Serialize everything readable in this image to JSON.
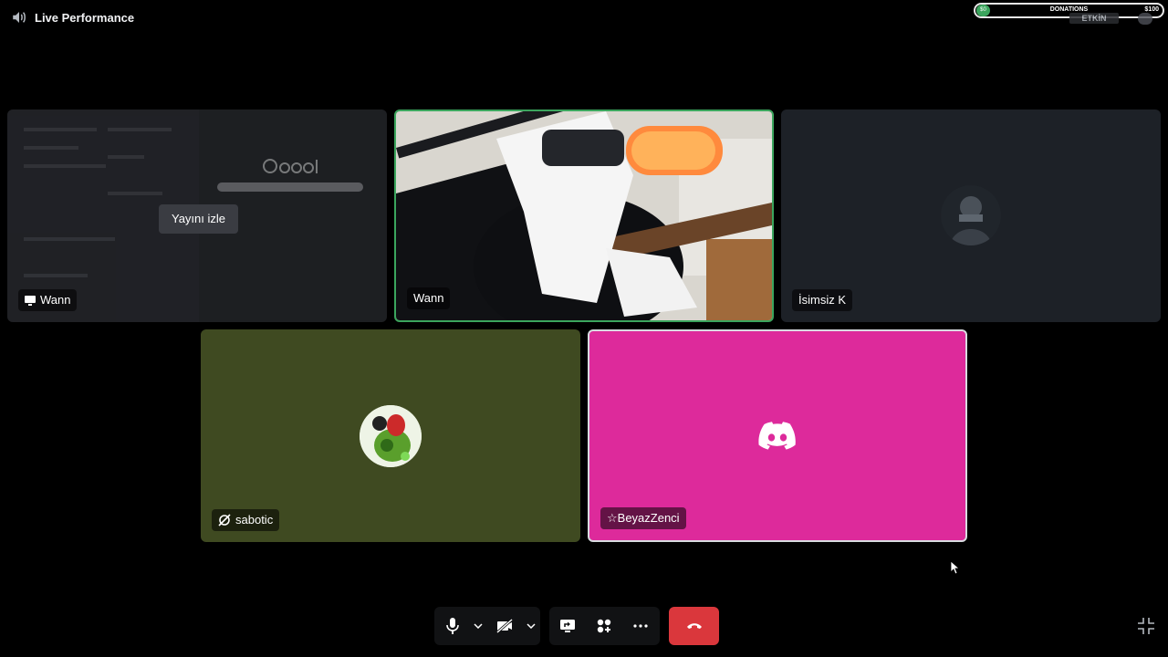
{
  "header": {
    "title": "Live Performance",
    "icon": "speaker-icon"
  },
  "overlay": {
    "donation_label": "DONATIONS",
    "donation_goal": "$100",
    "donation_badge": "$0",
    "status_badge": "ETKİN"
  },
  "tiles": [
    {
      "name": "Wann",
      "kind": "screen-share",
      "icon": "monitor-icon",
      "action_label": "Yayını izle",
      "bg": "#1b1c1f"
    },
    {
      "name": "Wann",
      "kind": "camera",
      "speaking": true,
      "bg": "#6b5a44"
    },
    {
      "name": "İsimsiz K",
      "kind": "avatar",
      "bg": "#1d2127"
    },
    {
      "name": "sabotic",
      "kind": "avatar",
      "icon": "camera-off-icon",
      "bg": "#3f4a21"
    },
    {
      "name": "☆BeyazZenci",
      "kind": "avatar",
      "icon": "discord-icon",
      "bg": "#dd2a9b"
    }
  ],
  "controls": {
    "mic": "microphone-icon",
    "camera": "camera-off-icon",
    "screen_share": "screen-share-icon",
    "activities": "activities-icon",
    "more": "more-icon",
    "hangup": "hangup-icon",
    "hangup_color": "#da373c"
  },
  "colors": {
    "speaking_border": "#3ba55d",
    "background": "#000000"
  }
}
